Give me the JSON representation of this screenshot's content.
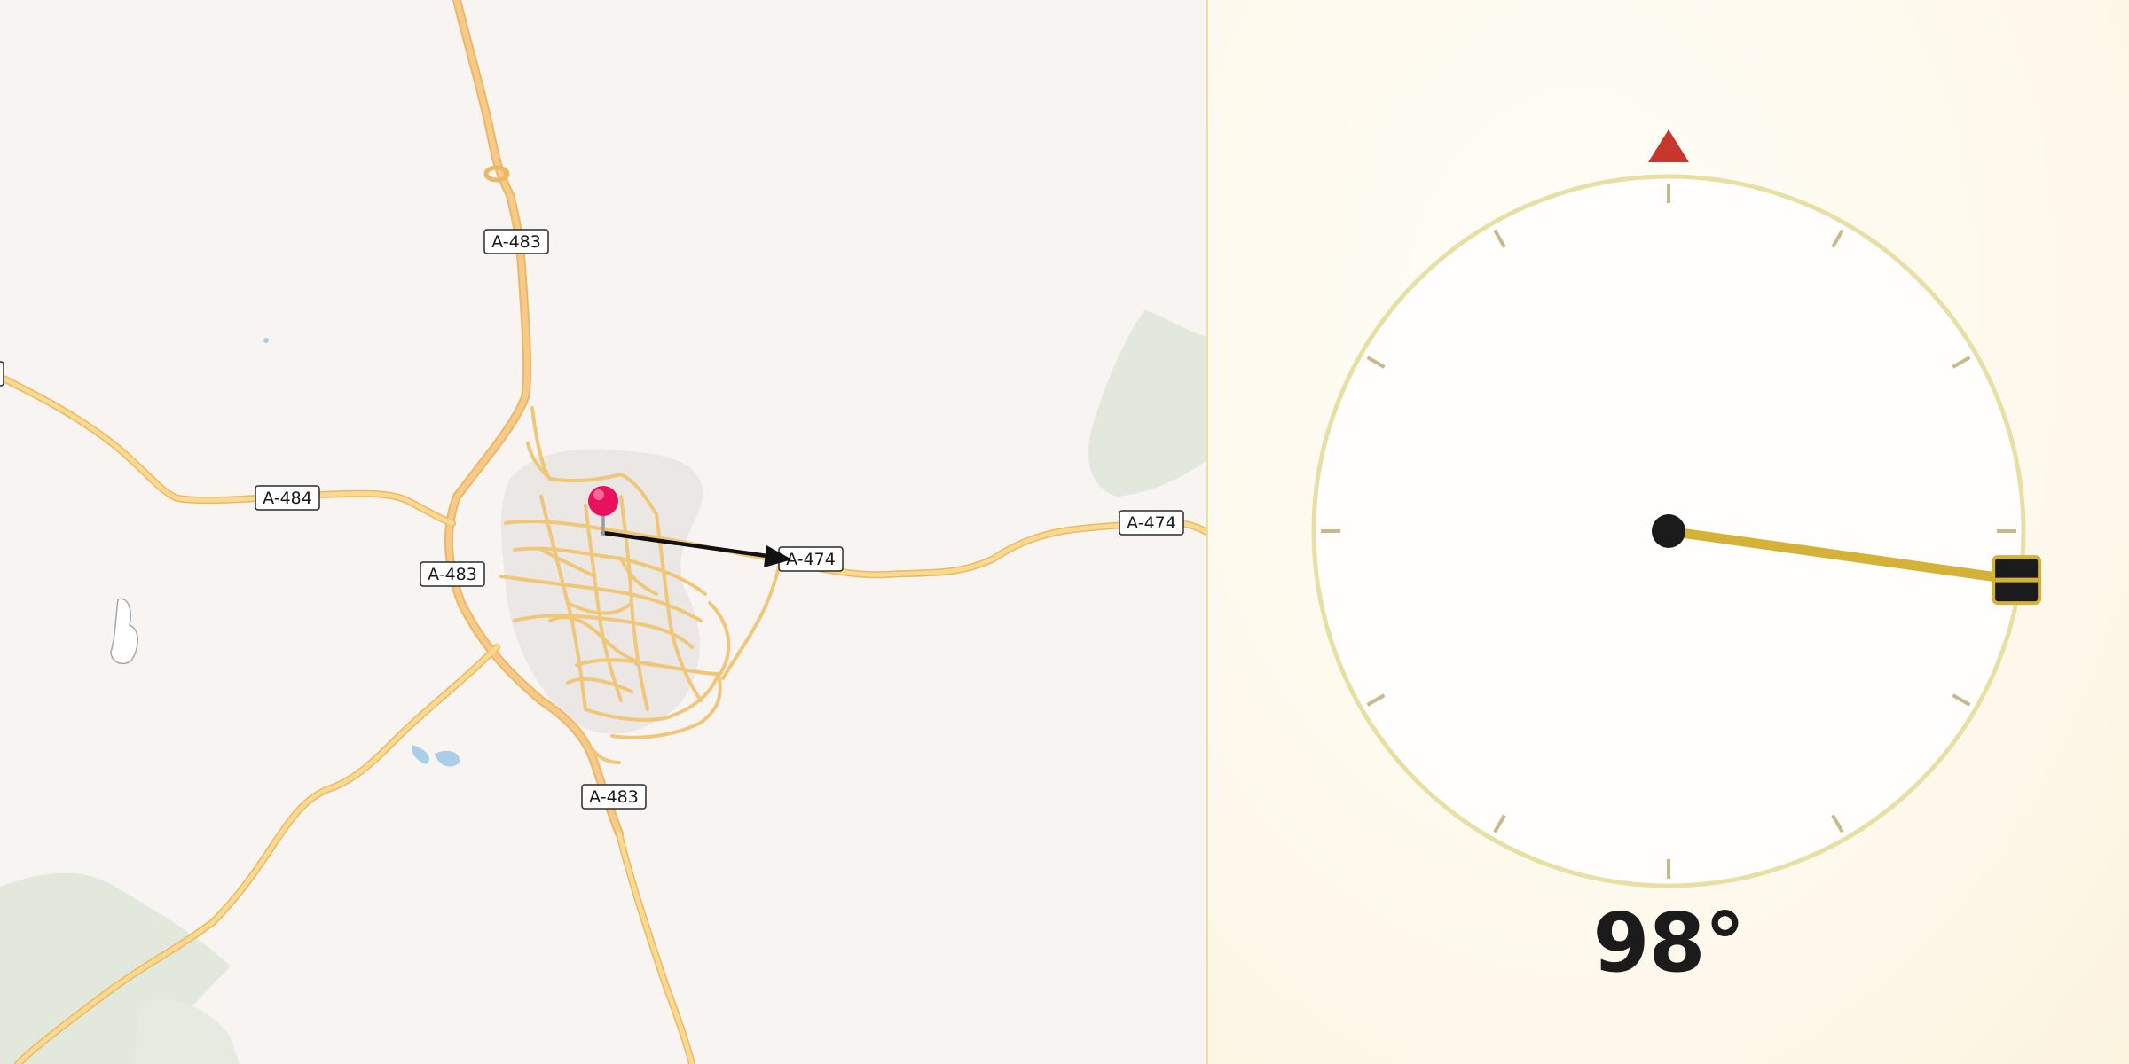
{
  "map": {
    "road_labels": [
      "A-483",
      "A-484",
      "A-483",
      "A-483",
      "A-474",
      "A-474"
    ],
    "colors": {
      "road_fill": "#fbd98e",
      "road_casing": "#e9b965",
      "major_road_fill": "#f9c98a",
      "land": "#f7f4f1",
      "urban": "#ebe7e4",
      "water": "#a9cfe8",
      "vegetation": "#dfe5d8",
      "pin": "#e8125c",
      "arrow": "#111111"
    },
    "marker_icon": "map-pin-icon",
    "direction_icon": "heading-arrow-icon"
  },
  "compass": {
    "heading": "98°",
    "heading_value_deg": 98,
    "north_marker_icon": "north-triangle-icon",
    "colors": {
      "ring": "#e8dfa5",
      "ticks": "#c9b98a",
      "needle": "#d4b238",
      "north": "#c8372d",
      "hub": "#1b1b1b"
    }
  }
}
